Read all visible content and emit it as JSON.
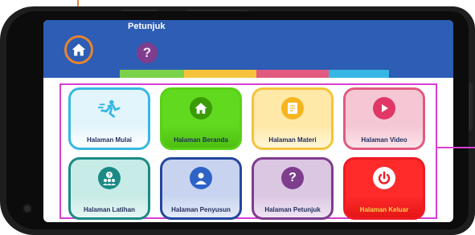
{
  "header": {
    "nav_label": "Petunjuk",
    "home_icon": "home-icon",
    "help_icon": "question-icon",
    "help_glyph": "?",
    "accent_color": "#e9832f"
  },
  "menu": {
    "items": [
      {
        "label": "Halaman Mulai",
        "icon": "runner-icon",
        "color": "#37b7e3"
      },
      {
        "label": "Halaman Beranda",
        "icon": "home-icon",
        "color": "#59d116"
      },
      {
        "label": "Halaman Materi",
        "icon": "document-icon",
        "color": "#f5c33b"
      },
      {
        "label": "Halaman Video",
        "icon": "play-icon",
        "color": "#e25a80"
      },
      {
        "label": "Halaman Latihan",
        "icon": "people-question-icon",
        "color": "#1b8a86"
      },
      {
        "label": "Halaman Penyusun",
        "icon": "user-icon",
        "color": "#2446a0"
      },
      {
        "label": "Halaman Petunjuk",
        "icon": "question-icon",
        "color": "#7e3d8d"
      },
      {
        "label": "Halaman Keluar",
        "icon": "power-icon",
        "color": "#ec1b24"
      }
    ]
  },
  "annotation_color": "#d83ed3"
}
